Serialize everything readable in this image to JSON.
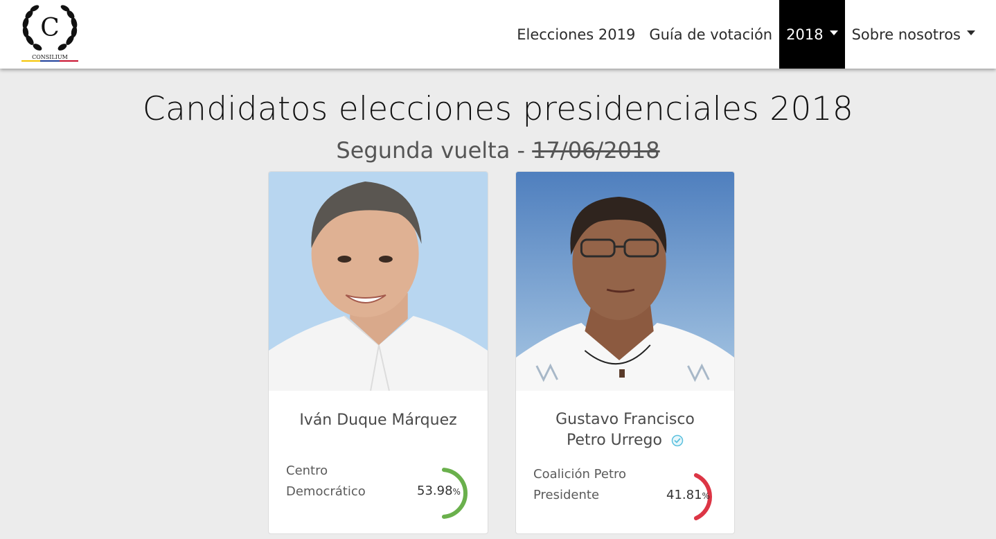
{
  "brand": {
    "logo_text": "CONSILIUM",
    "logo_letter": "C"
  },
  "nav": {
    "items": [
      {
        "label": "Elecciones 2019",
        "dropdown": false,
        "active": false
      },
      {
        "label": "Guía de votación",
        "dropdown": false,
        "active": false
      },
      {
        "label": "2018",
        "dropdown": true,
        "active": true
      },
      {
        "label": "Sobre nosotros",
        "dropdown": true,
        "active": false
      }
    ]
  },
  "page": {
    "title": "Candidatos elecciones presidenciales 2018",
    "subtitle_prefix": "Segunda vuelta - ",
    "subtitle_date": "17/06/2018"
  },
  "candidates": [
    {
      "name_line1": "Iván Duque Márquez",
      "name_line2": "",
      "party_line1": "Centro",
      "party_line2": "Democrático",
      "percent": "53.98",
      "percent_value": 53.98,
      "percent_symbol": "%",
      "color": "#6ab04c",
      "verified": false,
      "photo_bg": "#b8d6f0"
    },
    {
      "name_line1": "Gustavo Francisco",
      "name_line2": "Petro Urrego",
      "party_line1": "Coalición Petro",
      "party_line2": "Presidente",
      "percent": "41.81",
      "percent_value": 41.81,
      "percent_symbol": "%",
      "color": "#dc3545",
      "verified": true,
      "photo_bg": "#5d8ec4"
    }
  ],
  "colors": {
    "background": "#ececec",
    "nav_active_bg": "#000000",
    "verified_icon": "#5bc0de"
  }
}
